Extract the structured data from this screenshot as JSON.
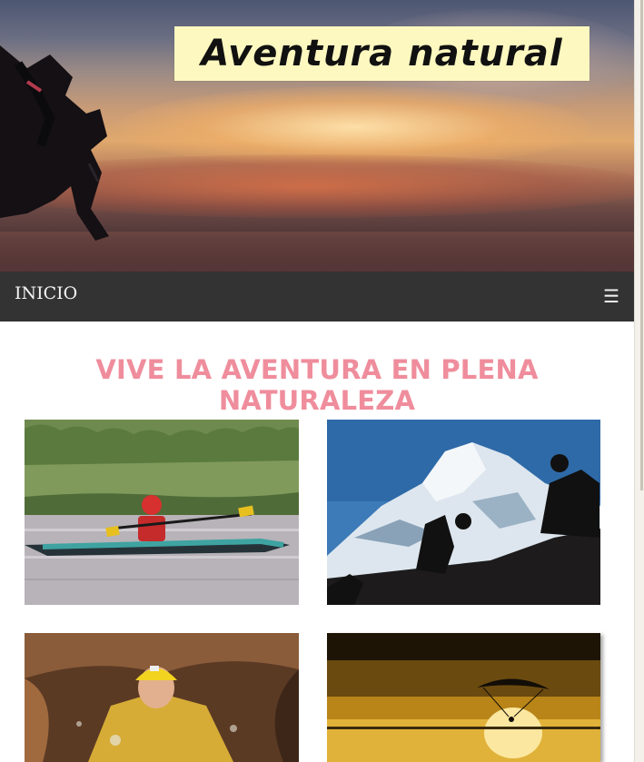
{
  "header": {
    "logo_text": "Aventura natural"
  },
  "nav": {
    "home_label": "INICIO",
    "menu_glyph": "☰"
  },
  "main": {
    "title": "VIVE LA AVENTURA EN PLENA NATURALEZA",
    "gallery": [
      {
        "subject": "kayaking"
      },
      {
        "subject": "mountain-hiking"
      },
      {
        "subject": "caving"
      },
      {
        "subject": "paragliding"
      }
    ]
  },
  "colors": {
    "nav_background": "#333333",
    "title_pink": "#ef8d9c",
    "logo_background": "#fdf8bf"
  }
}
